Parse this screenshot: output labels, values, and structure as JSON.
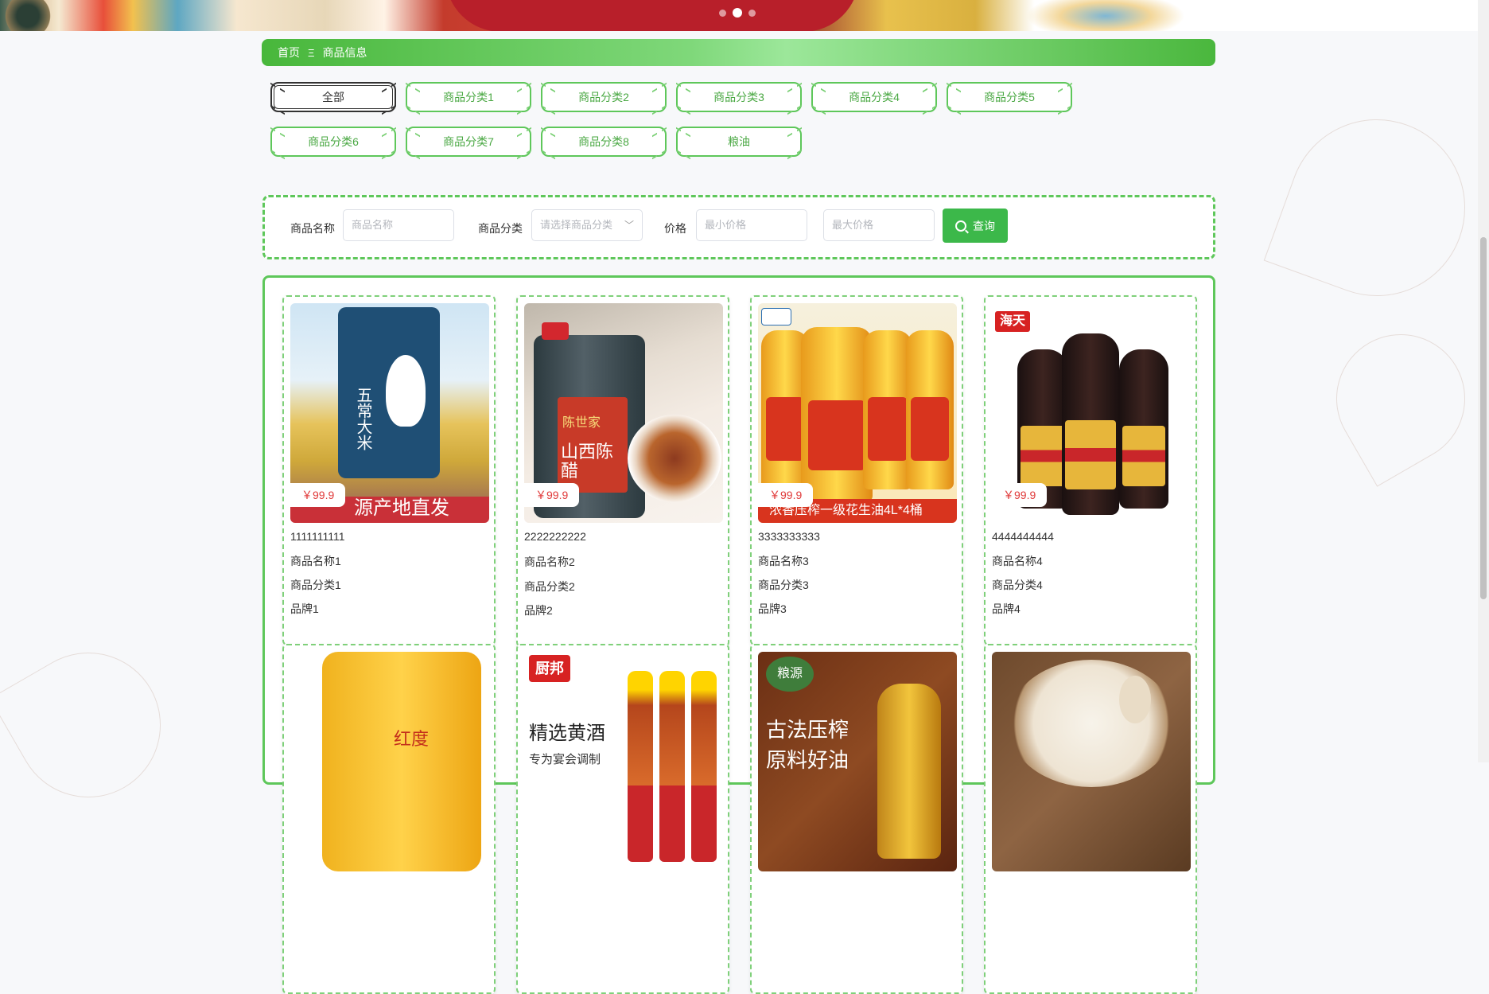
{
  "banner": {
    "dots": 3,
    "active_dot": 2
  },
  "breadcrumb": {
    "home": "首页",
    "separator": "Ξ",
    "current": "商品信息"
  },
  "categories": [
    {
      "label": "全部",
      "active": true
    },
    {
      "label": "商品分类1"
    },
    {
      "label": "商品分类2"
    },
    {
      "label": "商品分类3"
    },
    {
      "label": "商品分类4"
    },
    {
      "label": "商品分类5"
    },
    {
      "label": "商品分类6"
    },
    {
      "label": "商品分类7"
    },
    {
      "label": "商品分类8"
    },
    {
      "label": "粮油"
    }
  ],
  "search": {
    "name_label": "商品名称",
    "name_placeholder": "商品名称",
    "category_label": "商品分类",
    "category_placeholder": "请选择商品分类",
    "price_label": "价格",
    "min_price_placeholder": "最小价格",
    "max_price_placeholder": "最大价格",
    "button_label": "查询"
  },
  "products": [
    {
      "price": "￥99.9",
      "title": "1111111111",
      "name": "商品名称1",
      "category": "商品分类1",
      "brand": "品牌1",
      "image_banner": "源产地直发",
      "image_text": "五常大米"
    },
    {
      "price": "￥99.9",
      "title": "2222222222",
      "name": "商品名称2",
      "category": "商品分类2",
      "brand": "品牌2",
      "image_text_a": "陈世家",
      "image_text_b": "山西陈醋"
    },
    {
      "price": "￥99.9",
      "title": "3333333333",
      "name": "商品名称3",
      "category": "商品分类3",
      "brand": "品牌3",
      "image_banner": "浓香压榨一级花生油4L*4桶"
    },
    {
      "price": "￥99.9",
      "title": "4444444444",
      "name": "商品名称4",
      "category": "商品分类4",
      "brand": "品牌4",
      "image_logo": "海天"
    },
    {
      "image_text": "红度"
    },
    {
      "image_logo": "厨邦",
      "image_title": "精选黄酒",
      "image_sub": "专为宴会调制"
    },
    {
      "image_logo": "粮源",
      "image_t1": "古法压榨",
      "image_t2": "原料好油"
    },
    {}
  ],
  "colors": {
    "accent": "#5ec75a",
    "button": "#3cb84a",
    "price": "#e03a3a"
  }
}
